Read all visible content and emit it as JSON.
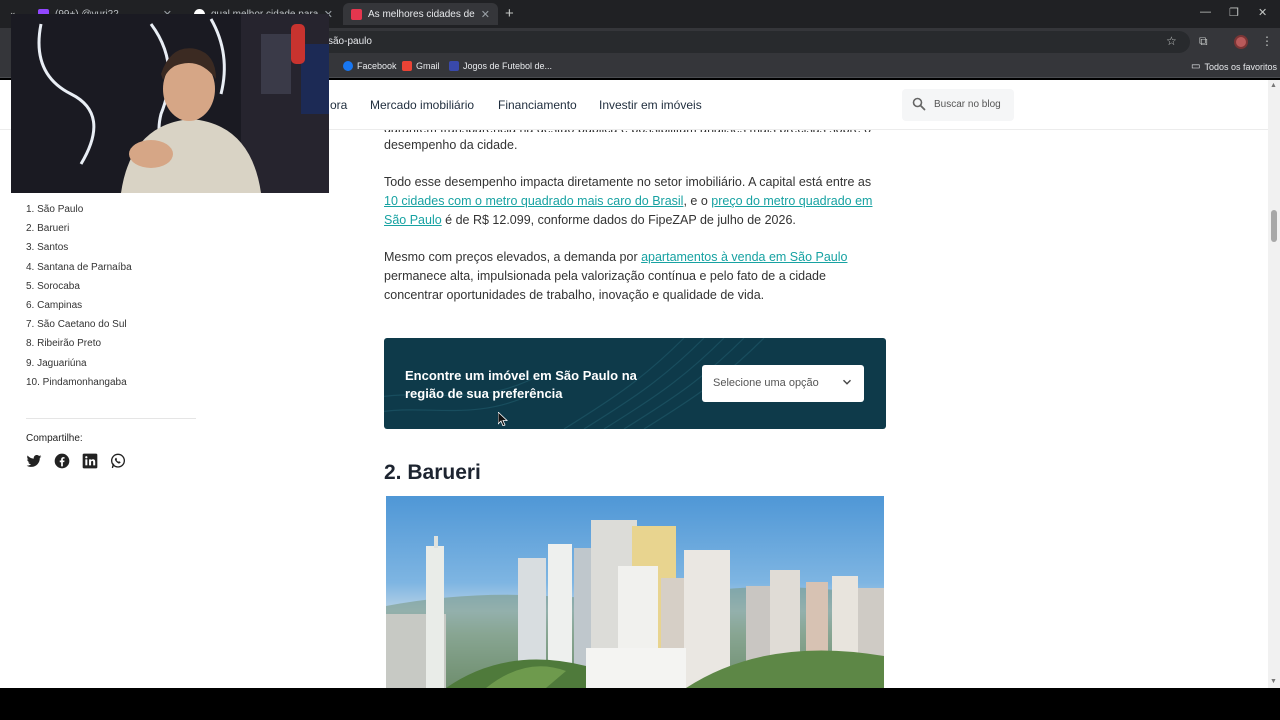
{
  "browser": {
    "tabs": [
      {
        "title": "(99+) @yuri22",
        "active": false
      },
      {
        "title": "qual melhor cidade para mora",
        "active": false
      },
      {
        "title": "As melhores cidades de São Pa",
        "active": true
      }
    ],
    "url_visible": "são-paulo",
    "bookmarks": [
      "Facebook",
      "Gmail",
      "Jogos de Futebol de..."
    ],
    "all_favorites": "Todos os favoritos"
  },
  "site_nav": {
    "links": [
      "ora",
      "Mercado imobiliário",
      "Financiamento",
      "Investir em imóveis"
    ],
    "search_placeholder": "Buscar no blog"
  },
  "toc": {
    "items": [
      "1. São Paulo",
      "2. Barueri",
      "3. Santos",
      "4. Santana de Parnaíba",
      "5. Sorocaba",
      "6. Campinas",
      "7. São Caetano do Sul",
      "8. Ribeirão Preto",
      "9. Jaguariúna",
      "10. Pindamonhangaba"
    ],
    "share_label": "Compartilhe:"
  },
  "article": {
    "cut_line": "garantem transparência na gestão pública e possibilitam análises mais precisas sobre o",
    "p1_end": "desempenho da cidade.",
    "p2_a": "Todo esse desempenho impacta diretamente no setor imobiliário. A capital está entre as ",
    "p2_link1": "10 cidades com o metro quadrado mais caro do Brasil",
    "p2_b": ", e o ",
    "p2_link2": "preço do metro quadrado em São Paulo",
    "p2_c": " é de R$ 12.099, conforme dados do FipeZAP de julho de 2026.",
    "p3_a": "Mesmo com preços elevados, a demanda por ",
    "p3_link": "apartamentos à venda em São Paulo",
    "p3_b": " permanece alta, impulsionada pela valorização contínua e pelo fato de a cidade concentrar oportunidades de trabalho, inovação e qualidade de vida.",
    "cta_title": "Encontre um imóvel em São Paulo na região de sua preferência",
    "cta_select": "Selecione uma opção",
    "h2": "2. Barueri"
  },
  "colors": {
    "link": "#17a2a2",
    "cta_bg": "#0e3a4a",
    "chrome_dark": "#202124"
  }
}
